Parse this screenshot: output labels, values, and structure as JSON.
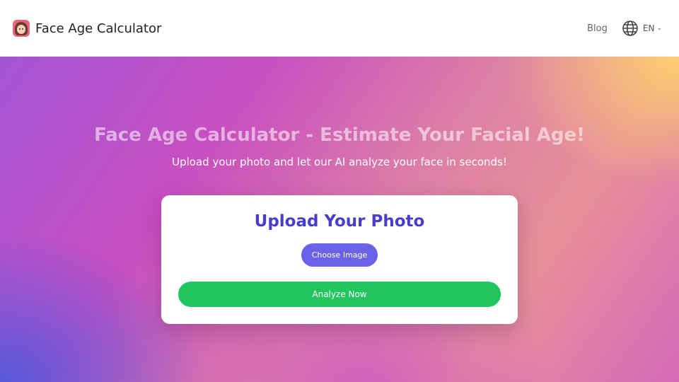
{
  "header": {
    "brand_name": "Face Age Calculator",
    "logo_icon": "face-avatar-icon",
    "nav": {
      "blog_label": "Blog",
      "language_icon": "globe-icon",
      "language_code": "EN",
      "language_chevron": "chevron-down-icon"
    }
  },
  "hero": {
    "title": "Face Age Calculator - Estimate Your Facial Age!",
    "subtitle": "Upload your photo and let our AI analyze your face in seconds!"
  },
  "upload_card": {
    "title": "Upload Your Photo",
    "choose_button": "Choose Image",
    "analyze_button": "Analyze Now"
  },
  "colors": {
    "brand_purple": "#4a3ec9",
    "choose_button": "#6a63e8",
    "analyze_button": "#22c55e"
  }
}
